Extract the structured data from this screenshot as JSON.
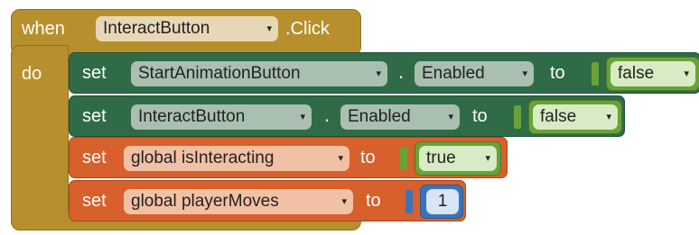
{
  "event": {
    "when": "when",
    "component": "InteractButton",
    "event_suffix": ".Click",
    "do": "do"
  },
  "colors": {
    "event_block": "#b7902d",
    "component_set_block": "#2f6b46",
    "variable_set_block": "#d7602c",
    "logic_literal": "#6aa239",
    "number_literal": "#3d73b8"
  },
  "statements": [
    {
      "set": "set",
      "component": "StartAnimationButton",
      "dot": ".",
      "property": "Enabled",
      "to": "to",
      "value": "false"
    },
    {
      "set": "set",
      "component": "InteractButton",
      "dot": ".",
      "property": "Enabled",
      "to": "to",
      "value": "false"
    },
    {
      "set": "set",
      "variable": "global isInteracting",
      "to": "to",
      "value": "true"
    },
    {
      "set": "set",
      "variable": "global playerMoves",
      "to": "to",
      "value": "1"
    }
  ],
  "icons": {
    "dropdown": "▾"
  }
}
